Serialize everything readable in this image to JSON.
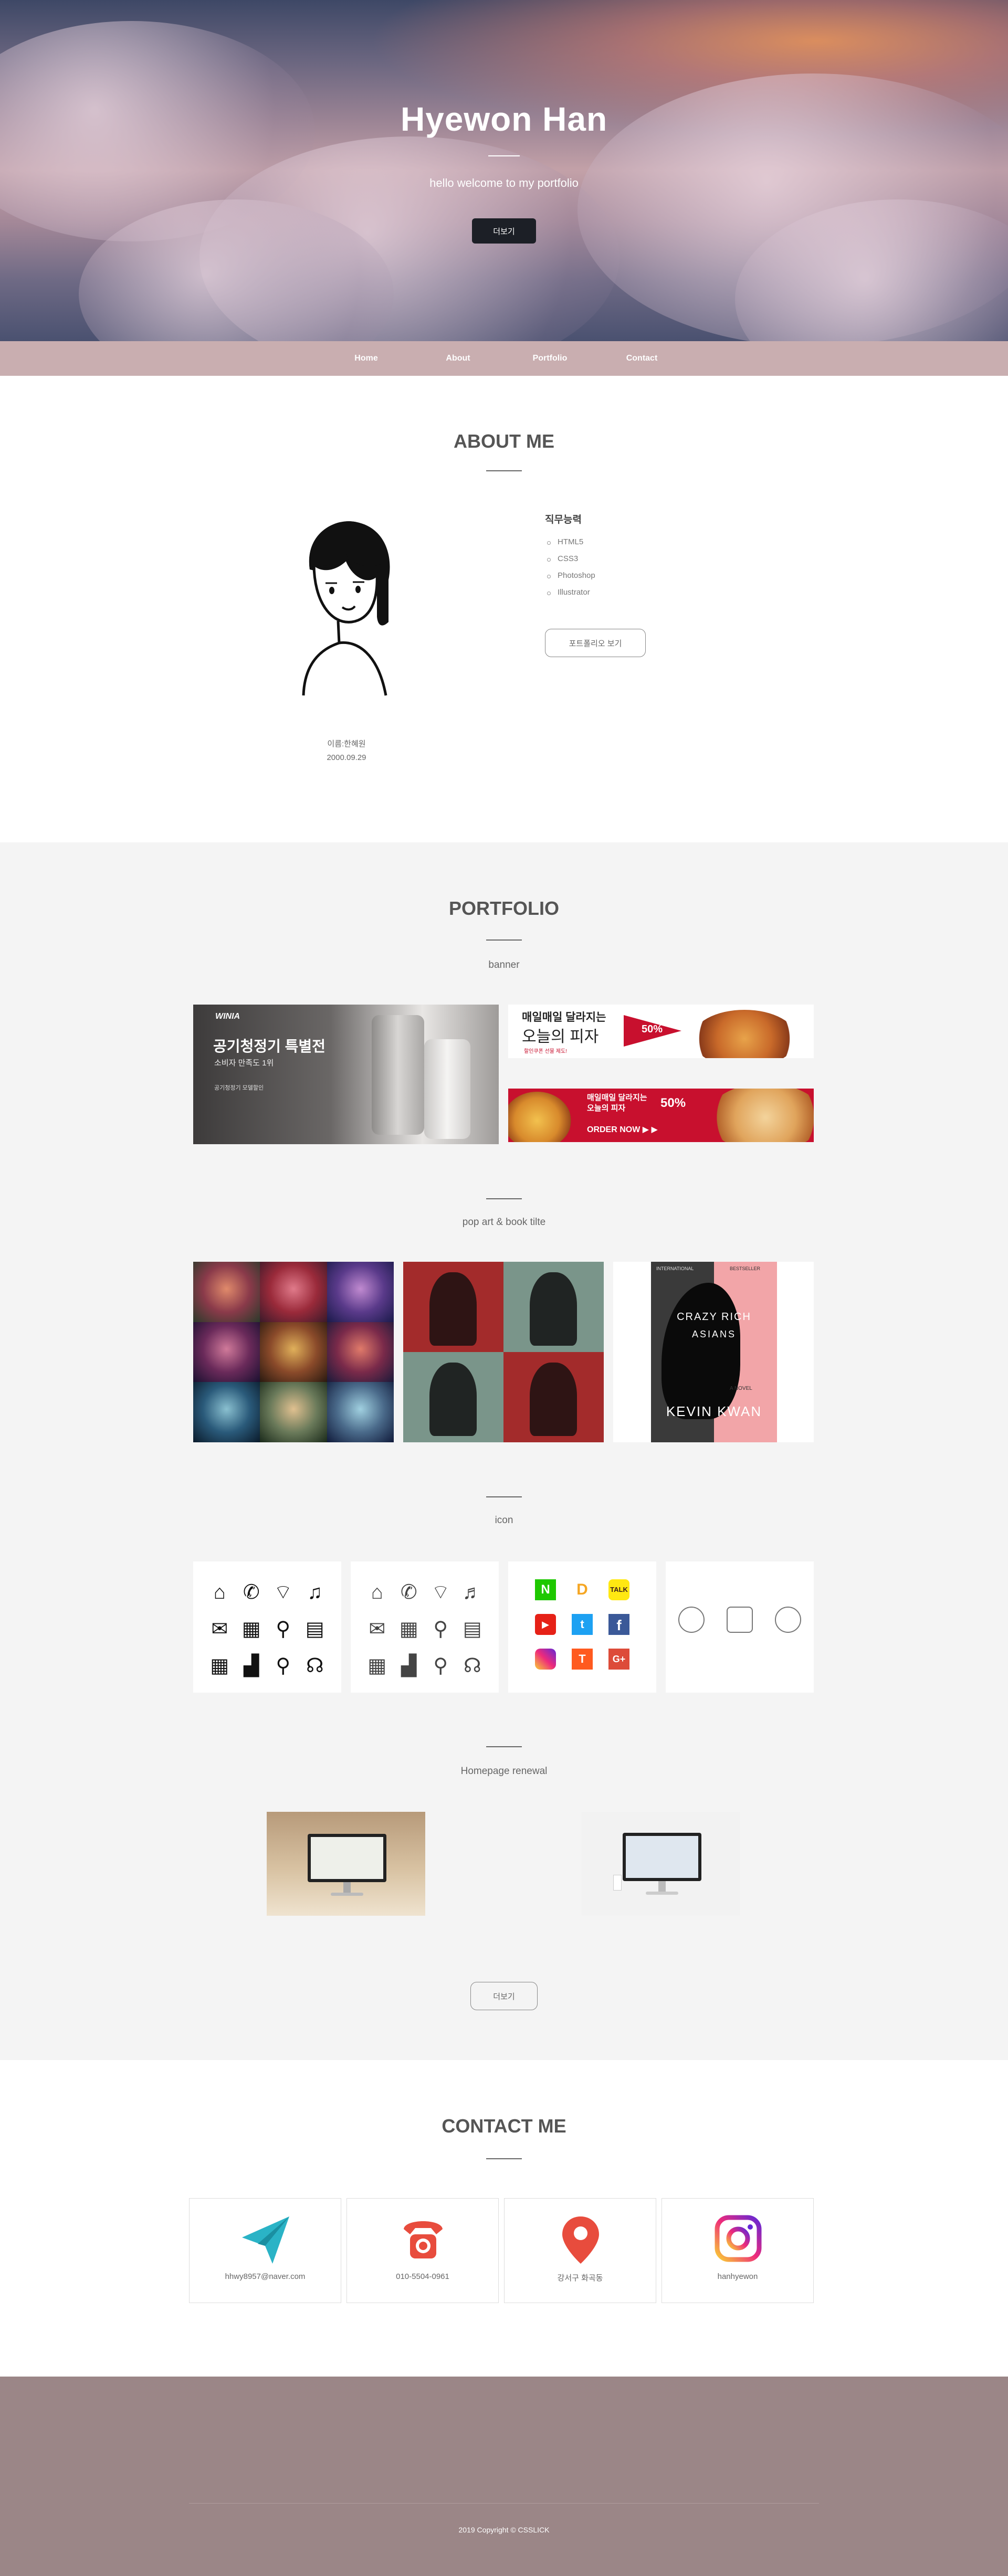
{
  "hero": {
    "title": "Hyewon Han",
    "subtitle": "hello welcome to my portfolio",
    "button_label": "더보기"
  },
  "nav": {
    "items": [
      "Home",
      "About",
      "Portfolio",
      "Contact"
    ]
  },
  "about": {
    "title": "ABOUT ME",
    "name": "이름:한혜원",
    "birth": "2000.09.29",
    "skills_heading": "직무능력",
    "skills": [
      "HTML5",
      "CSS3",
      "Photoshop",
      "Illustrator"
    ],
    "portfolio_button": "포트폴리오 보기"
  },
  "portfolio": {
    "title": "PORTFOLIO",
    "banner_heading": "banner",
    "banner1": {
      "brand": "WINIA",
      "headline": "공기청정기 특별전",
      "sub": "소비자 만족도 1위",
      "tag": "공기청정기 모델할인"
    },
    "banner2": {
      "line1": "매일매일 달라지는",
      "line2": "오늘의 피자",
      "line3": "할인쿠폰 선물 제도!",
      "badge": "50%"
    },
    "banner3": {
      "line1": "매일매일 달라지는",
      "line2": "오늘의 피자",
      "badge": "50%",
      "cta": "ORDER NOW ▶ ▶"
    },
    "popart_heading": "pop art & book tilte",
    "book": {
      "top_left": "INTERNATIONAL",
      "top_right": "BESTSELLER",
      "title1": "CRAZY RICH",
      "title2": "ASIANS",
      "tag": "A NOVEL",
      "author": "KEVIN KWAN"
    },
    "icon_heading": "icon",
    "renewal_heading": "Homepage renewal",
    "more_button": "더보기"
  },
  "contact": {
    "title": "CONTACT ME",
    "items": [
      {
        "text": "hhwy8957@naver.com",
        "icon": "paper-plane-icon"
      },
      {
        "text": "010-5504-0961",
        "icon": "phone-icon"
      },
      {
        "text": "강서구 화곡동",
        "icon": "location-pin-icon"
      },
      {
        "text": "hanhyewon",
        "icon": "instagram-icon"
      }
    ]
  },
  "footer": {
    "copyright": "2019 Copyright © CSSLICK"
  },
  "colors": {
    "nav_bg": "#c9aeb0",
    "footer_bg": "#9b8687",
    "section_bg": "#f4f4f4",
    "pizza_red": "#c8102e",
    "book_pink": "#f2a5a8"
  }
}
